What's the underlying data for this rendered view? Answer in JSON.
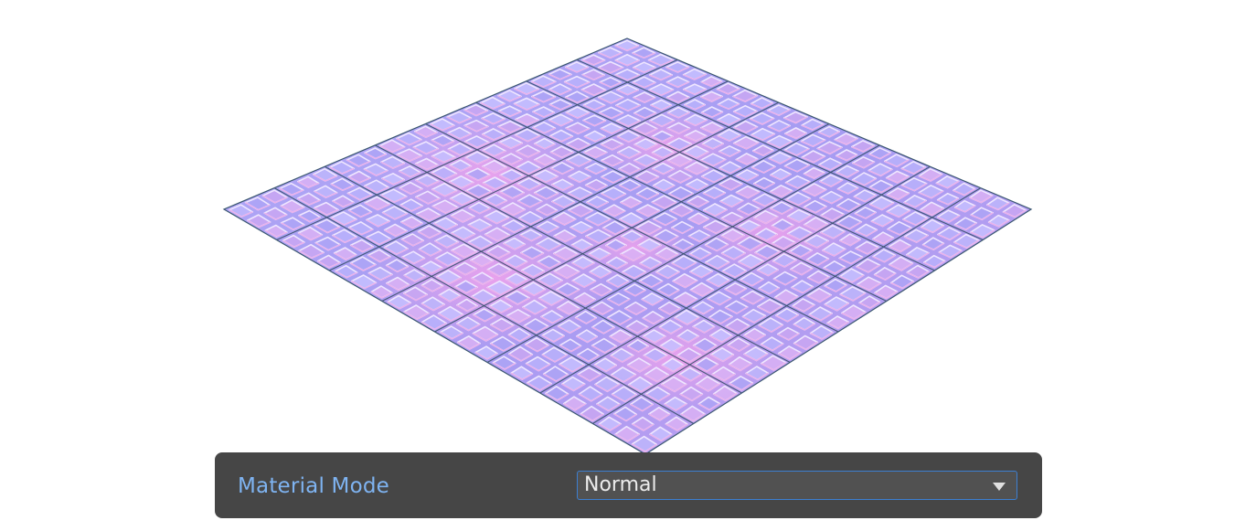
{
  "viewport": {
    "subject": "normal-mapped cobblestone plane",
    "colors": {
      "background": "#ffffff",
      "tile_base": "#a49af0",
      "tile_pink": "#e9a2f2",
      "tile_highlight": "#c8c0ff",
      "grout": "#2f4c63"
    }
  },
  "panel": {
    "material_mode_label": "Material Mode",
    "material_mode_value": "Normal",
    "colors": {
      "panel_bg": "#464646",
      "label": "#7fb4f2",
      "field_bg": "#515151",
      "field_border": "#3c7fd1",
      "field_text": "#ececec"
    },
    "icons": [
      "dropdown-caret-icon"
    ]
  }
}
